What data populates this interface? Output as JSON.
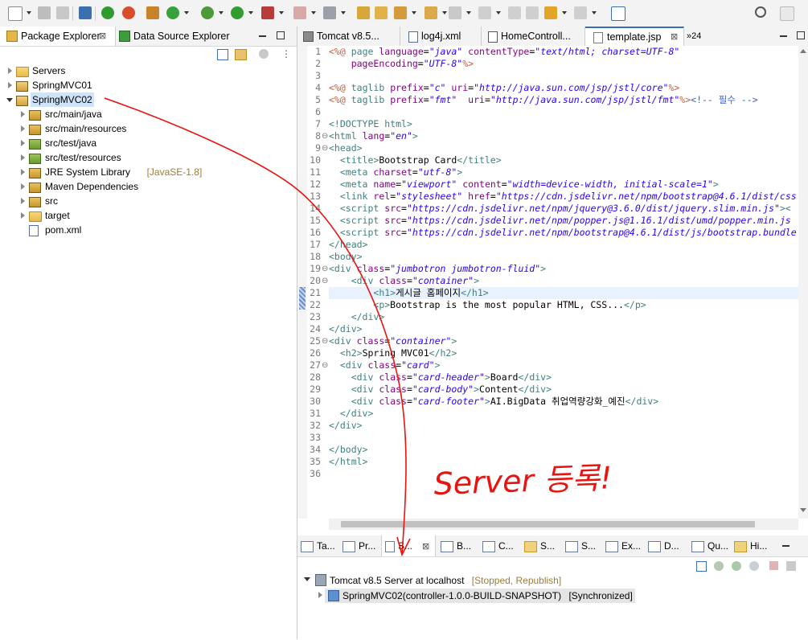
{
  "toolbar": {
    "icons": [
      "new-icon",
      "save-icon",
      "save-all-icon",
      "terminal-icon",
      "power-icon",
      "refresh-icon",
      "build-icon",
      "settings-icon",
      "debug-icon",
      "run-icon",
      "external-tools-icon",
      "stop-icon",
      "deploy-icon",
      "open-folder-icon",
      "open-icon",
      "pen-icon",
      "open-type-icon",
      "next-annotation-icon",
      "previous-annotation-icon",
      "back-icon",
      "forward-icon",
      "back-history-icon",
      "forward-history-icon",
      "new-window-icon",
      "search-icon"
    ]
  },
  "left": {
    "tabs": [
      {
        "label": "Package Explorer",
        "close": "⊠"
      },
      {
        "label": "Data Source Explorer"
      }
    ],
    "tree": [
      {
        "label": "Servers",
        "indent": 0,
        "icon": "folder-icon",
        "open": false
      },
      {
        "label": "SpringMVC01",
        "indent": 0,
        "icon": "maven-project-icon",
        "open": false
      },
      {
        "label": "SpringMVC02",
        "indent": 0,
        "icon": "maven-project-icon",
        "open": true,
        "selected": true
      },
      {
        "label": "src/main/java",
        "indent": 1,
        "icon": "source-folder-icon",
        "open": false
      },
      {
        "label": "src/main/resources",
        "indent": 1,
        "icon": "source-folder-icon",
        "open": false
      },
      {
        "label": "src/test/java",
        "indent": 1,
        "icon": "test-folder-icon",
        "open": false
      },
      {
        "label": "src/test/resources",
        "indent": 1,
        "icon": "test-folder-icon",
        "open": false
      },
      {
        "label": "JRE System Library",
        "suffix": "[JavaSE-1.8]",
        "indent": 1,
        "icon": "library-icon",
        "open": false
      },
      {
        "label": "Maven Dependencies",
        "indent": 1,
        "icon": "library-icon",
        "open": false
      },
      {
        "label": "src",
        "indent": 1,
        "icon": "src-folder-icon",
        "open": false
      },
      {
        "label": "target",
        "indent": 1,
        "icon": "folder-icon",
        "open": false
      },
      {
        "label": "pom.xml",
        "indent": 1,
        "icon": "maven-file-icon",
        "leaf": true
      }
    ]
  },
  "editor": {
    "tabs": [
      "Tomcat v8.5...",
      "log4j.xml",
      "HomeControll...",
      "template.jsp"
    ],
    "overflow": "»24",
    "lines": [
      [
        [
          "d",
          "<%@"
        ],
        [
          "t",
          " "
        ],
        [
          "k",
          "page"
        ],
        [
          "t",
          " "
        ],
        [
          "a",
          "language"
        ],
        [
          "t",
          "="
        ],
        [
          "s",
          "\"java\""
        ],
        [
          "t",
          " "
        ],
        [
          "a",
          "contentType"
        ],
        [
          "t",
          "="
        ],
        [
          "s",
          "\"text/html; charset=UTF-8\""
        ]
      ],
      [
        [
          "t",
          "    "
        ],
        [
          "a",
          "pageEncoding"
        ],
        [
          "t",
          "="
        ],
        [
          "s",
          "\"UTF-8\""
        ],
        [
          "d",
          "%>"
        ]
      ],
      [],
      [
        [
          "d",
          "<%@"
        ],
        [
          "t",
          " "
        ],
        [
          "k",
          "taglib"
        ],
        [
          "t",
          " "
        ],
        [
          "a",
          "prefix"
        ],
        [
          "t",
          "="
        ],
        [
          "s",
          "\"c\""
        ],
        [
          "t",
          " "
        ],
        [
          "a",
          "uri"
        ],
        [
          "t",
          "="
        ],
        [
          "s",
          "\"http://java.sun.com/jsp/jstl/core\""
        ],
        [
          "d",
          "%>"
        ]
      ],
      [
        [
          "d",
          "<%@"
        ],
        [
          "t",
          " "
        ],
        [
          "k",
          "taglib"
        ],
        [
          "t",
          " "
        ],
        [
          "a",
          "prefix"
        ],
        [
          "t",
          "="
        ],
        [
          "s",
          "\"fmt\""
        ],
        [
          "t",
          "  "
        ],
        [
          "a",
          "uri"
        ],
        [
          "t",
          "="
        ],
        [
          "s",
          "\"http://java.sun.com/jsp/jstl/fmt\""
        ],
        [
          "d",
          "%>"
        ],
        [
          "c",
          "<!-- 필수 -->"
        ]
      ],
      [],
      [
        [
          "tg",
          "<!DOCTYPE html>"
        ]
      ],
      [
        [
          "tg",
          "<html"
        ],
        [
          "t",
          " "
        ],
        [
          "a",
          "lang"
        ],
        [
          "t",
          "="
        ],
        [
          "s",
          "\"en\""
        ],
        [
          "tg",
          ">"
        ]
      ],
      [
        [
          "tg",
          "<head>"
        ]
      ],
      [
        [
          "t",
          "  "
        ],
        [
          "tg",
          "<title>"
        ],
        [
          "t",
          "Bootstrap Card"
        ],
        [
          "tg",
          "</title>"
        ]
      ],
      [
        [
          "t",
          "  "
        ],
        [
          "tg",
          "<meta"
        ],
        [
          "t",
          " "
        ],
        [
          "a",
          "charset"
        ],
        [
          "t",
          "="
        ],
        [
          "s",
          "\"utf-8\""
        ],
        [
          "tg",
          ">"
        ]
      ],
      [
        [
          "t",
          "  "
        ],
        [
          "tg",
          "<meta"
        ],
        [
          "t",
          " "
        ],
        [
          "a",
          "name"
        ],
        [
          "t",
          "="
        ],
        [
          "s",
          "\"viewport\""
        ],
        [
          "t",
          " "
        ],
        [
          "a",
          "content"
        ],
        [
          "t",
          "="
        ],
        [
          "s",
          "\"width=device-width, initial-scale=1\""
        ],
        [
          "tg",
          ">"
        ]
      ],
      [
        [
          "t",
          "  "
        ],
        [
          "tg",
          "<link"
        ],
        [
          "t",
          " "
        ],
        [
          "a",
          "rel"
        ],
        [
          "t",
          "="
        ],
        [
          "s",
          "\"stylesheet\""
        ],
        [
          "t",
          " "
        ],
        [
          "a",
          "href"
        ],
        [
          "t",
          "="
        ],
        [
          "s",
          "\"https://cdn.jsdelivr.net/npm/bootstrap@4.6.1/dist/css"
        ]
      ],
      [
        [
          "t",
          "  "
        ],
        [
          "tg",
          "<script"
        ],
        [
          "t",
          " "
        ],
        [
          "a",
          "src"
        ],
        [
          "t",
          "="
        ],
        [
          "s",
          "\"https://cdn.jsdelivr.net/npm/jquery@3.6.0/dist/jquery.slim.min.js\""
        ],
        [
          "tg",
          "><"
        ]
      ],
      [
        [
          "t",
          "  "
        ],
        [
          "tg",
          "<script"
        ],
        [
          "t",
          " "
        ],
        [
          "a",
          "src"
        ],
        [
          "t",
          "="
        ],
        [
          "s",
          "\"https://cdn.jsdelivr.net/npm/popper.js@1.16.1/dist/umd/popper.min.js"
        ]
      ],
      [
        [
          "t",
          "  "
        ],
        [
          "tg",
          "<script"
        ],
        [
          "t",
          " "
        ],
        [
          "a",
          "src"
        ],
        [
          "t",
          "="
        ],
        [
          "s",
          "\"https://cdn.jsdelivr.net/npm/bootstrap@4.6.1/dist/js/bootstrap.bundle"
        ]
      ],
      [
        [
          "tg",
          "</head>"
        ]
      ],
      [
        [
          "tg",
          "<body>"
        ]
      ],
      [
        [
          "tg",
          "<div"
        ],
        [
          "t",
          " "
        ],
        [
          "a",
          "class"
        ],
        [
          "t",
          "="
        ],
        [
          "s",
          "\"jumbotron jumbotron-fluid\""
        ],
        [
          "tg",
          ">"
        ]
      ],
      [
        [
          "t",
          "    "
        ],
        [
          "tg",
          "<div"
        ],
        [
          "t",
          " "
        ],
        [
          "a",
          "class"
        ],
        [
          "t",
          "="
        ],
        [
          "s",
          "\"container\""
        ],
        [
          "tg",
          ">"
        ]
      ],
      [
        [
          "t",
          "        "
        ],
        [
          "tg",
          "<h1>"
        ],
        [
          "t",
          "게시글 홈페이지"
        ],
        [
          "tg",
          "</h1>"
        ]
      ],
      [
        [
          "t",
          "        "
        ],
        [
          "tg",
          "<p>"
        ],
        [
          "t",
          "Bootstrap is the most popular HTML, CSS..."
        ],
        [
          "tg",
          "</p>"
        ]
      ],
      [
        [
          "t",
          "    "
        ],
        [
          "tg",
          "</div>"
        ]
      ],
      [
        [
          "tg",
          "</div>"
        ]
      ],
      [
        [
          "tg",
          "<div"
        ],
        [
          "t",
          " "
        ],
        [
          "a",
          "class"
        ],
        [
          "t",
          "="
        ],
        [
          "s",
          "\"container\""
        ],
        [
          "tg",
          ">"
        ]
      ],
      [
        [
          "t",
          "  "
        ],
        [
          "tg",
          "<h2>"
        ],
        [
          "t",
          "Spring MVC01"
        ],
        [
          "tg",
          "</h2>"
        ]
      ],
      [
        [
          "t",
          "  "
        ],
        [
          "tg",
          "<div"
        ],
        [
          "t",
          " "
        ],
        [
          "a",
          "class"
        ],
        [
          "t",
          "="
        ],
        [
          "s",
          "\"card\""
        ],
        [
          "tg",
          ">"
        ]
      ],
      [
        [
          "t",
          "    "
        ],
        [
          "tg",
          "<div"
        ],
        [
          "t",
          " "
        ],
        [
          "a",
          "class"
        ],
        [
          "t",
          "="
        ],
        [
          "s",
          "\"card-header\""
        ],
        [
          "tg",
          ">"
        ],
        [
          "t",
          "Board"
        ],
        [
          "tg",
          "</div>"
        ]
      ],
      [
        [
          "t",
          "    "
        ],
        [
          "tg",
          "<div"
        ],
        [
          "t",
          " "
        ],
        [
          "a",
          "class"
        ],
        [
          "t",
          "="
        ],
        [
          "s",
          "\"card-body\""
        ],
        [
          "tg",
          ">"
        ],
        [
          "t",
          "Content"
        ],
        [
          "tg",
          "</div>"
        ]
      ],
      [
        [
          "t",
          "    "
        ],
        [
          "tg",
          "<div"
        ],
        [
          "t",
          " "
        ],
        [
          "a",
          "class"
        ],
        [
          "t",
          "="
        ],
        [
          "s",
          "\"card-footer\""
        ],
        [
          "tg",
          ">"
        ],
        [
          "t",
          "AI.BigData 취업역량강화_예진"
        ],
        [
          "tg",
          "</div>"
        ]
      ],
      [
        [
          "t",
          "  "
        ],
        [
          "tg",
          "</div>"
        ]
      ],
      [
        [
          "tg",
          "</div>"
        ]
      ],
      [],
      [
        [
          "tg",
          "</body>"
        ]
      ],
      [
        [
          "tg",
          "</html>"
        ]
      ],
      []
    ],
    "folds": [
      8,
      9,
      19,
      20,
      25,
      27
    ]
  },
  "bottom": {
    "tabs": [
      "Ta...",
      "Pr...",
      "S...",
      "B...",
      "C...",
      "S...",
      "S...",
      "Ex...",
      "D...",
      "Qu...",
      "Hi..."
    ],
    "server": {
      "label": "Tomcat v8.5 Server at localhost",
      "status": "[Stopped, Republish]"
    },
    "module": {
      "label": "SpringMVC02(controller-1.0.0-BUILD-SNAPSHOT)",
      "status": "[Synchronized]"
    }
  },
  "annotation": {
    "text": "Server 등록!",
    "color": "#e8140f"
  },
  "colors": {
    "toolbar": "#f3f3f3",
    "selection": "#cfe3fa",
    "current_line": "#e8f2fe"
  }
}
